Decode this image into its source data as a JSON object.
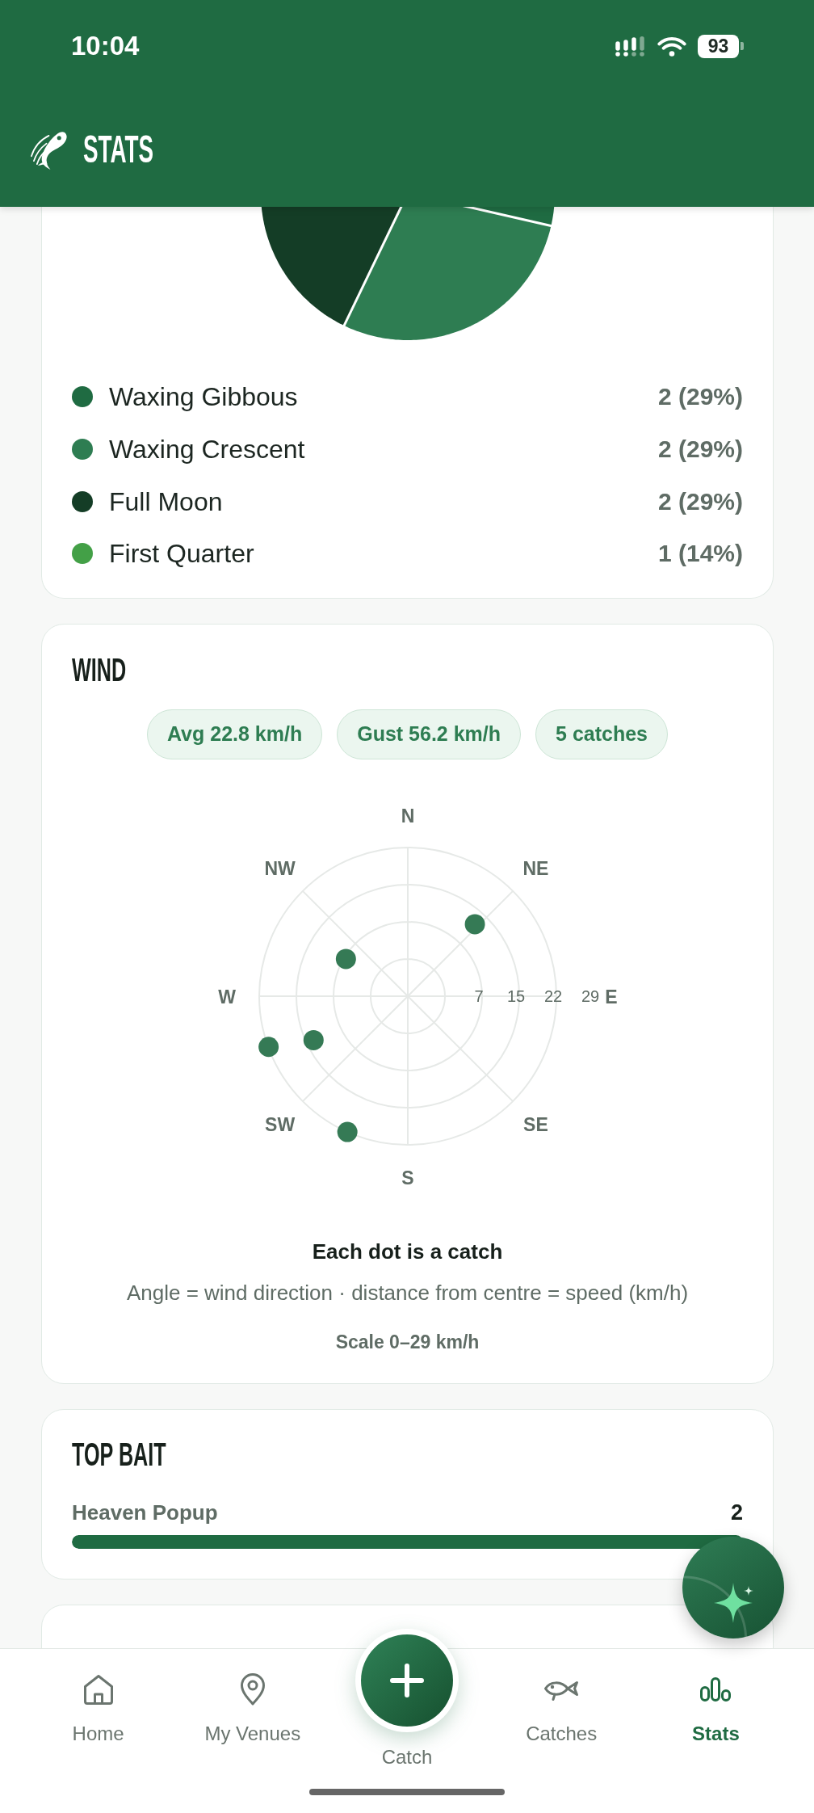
{
  "status_bar": {
    "time": "10:04",
    "battery": "93"
  },
  "header": {
    "title": "STATS"
  },
  "moon_phase_card": {
    "legend": [
      {
        "label": "Waxing Gibbous",
        "value": "2 (29%)",
        "color": "#1f6b42"
      },
      {
        "label": "Waxing Crescent",
        "value": "2 (29%)",
        "color": "#2e7d52"
      },
      {
        "label": "Full Moon",
        "value": "2 (29%)",
        "color": "#143d26"
      },
      {
        "label": "First Quarter",
        "value": "1 (14%)",
        "color": "#43a047"
      }
    ]
  },
  "wind_card": {
    "title": "WIND",
    "chips": [
      "Avg 22.8 km/h",
      "Gust 56.2 km/h",
      "5 catches"
    ],
    "compass_labels": [
      "N",
      "NE",
      "E",
      "SE",
      "S",
      "SW",
      "W",
      "NW"
    ],
    "scale_labels": [
      "7",
      "15",
      "22",
      "29"
    ],
    "caption_title": "Each dot is a catch",
    "caption": "Angle = wind direction · distance from centre = speed (km/h)",
    "scale": "Scale 0–29 km/h"
  },
  "top_bait_card": {
    "title": "TOP BAIT",
    "items": [
      {
        "label": "Heaven Popup",
        "count": "2",
        "level": 1
      }
    ]
  },
  "nav": {
    "items": [
      {
        "label": "Home",
        "kind": "home",
        "selected": false
      },
      {
        "label": "My Venues",
        "kind": "venues",
        "selected": false
      },
      {
        "label": "Catch",
        "kind": "add",
        "selected": false
      },
      {
        "label": "Catches",
        "kind": "catches",
        "selected": false
      },
      {
        "label": "Stats",
        "kind": "stats",
        "selected": true
      }
    ]
  }
}
